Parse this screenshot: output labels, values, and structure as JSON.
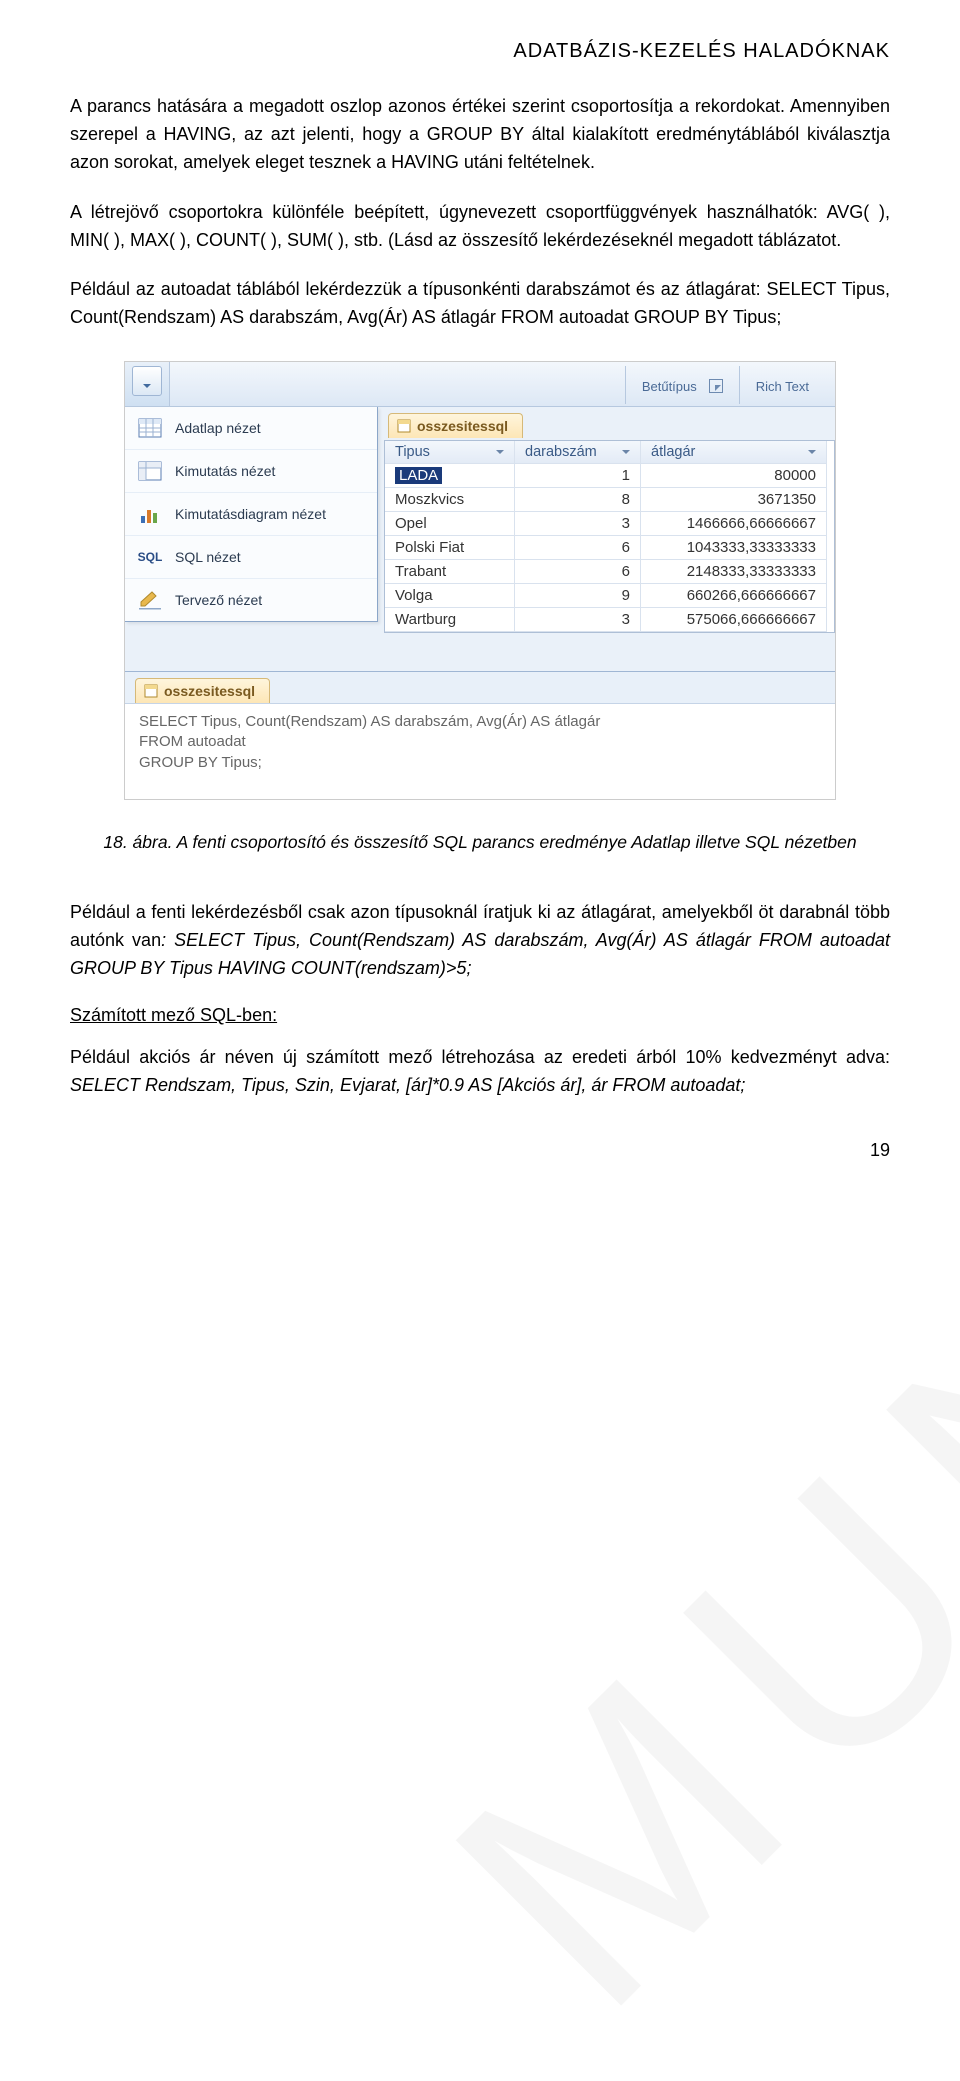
{
  "header": "ADATBÁZIS-KEZELÉS HALADÓKNAK",
  "para1": "A parancs hatására a megadott oszlop azonos értékei szerint csoportosítja a rekordokat. Amennyiben szerepel a HAVING, az azt jelenti, hogy a GROUP BY által kialakított eredménytáblából kiválasztja azon sorokat, amelyek eleget tesznek a HAVING utáni feltételnek.",
  "para2": "A létrejövő csoportokra különféle beépített, úgynevezett csoportfüggvények használhatók: AVG( ), MIN( ), MAX( ), COUNT( ), SUM( ),  stb. (Lásd az összesítő lekérdezéseknél megadott táblázatot.",
  "para3": "Például az autoadat táblából lekérdezzük a típusonkénti darabszámot és az átlagárat: SELECT Tipus, Count(Rendszam) AS darabszám, Avg(Ár) AS átlagár FROM autoadat GROUP BY Tipus;",
  "ribbon": {
    "group_font": "Betűtípus",
    "group_richtext": "Rich Text"
  },
  "view_menu": {
    "items": [
      {
        "label": "Adatlap nézet",
        "icon": "datasheet"
      },
      {
        "label": "Kimutatás nézet",
        "icon": "pivot"
      },
      {
        "label": "Kimutatásdiagram nézet",
        "icon": "pivotchart"
      },
      {
        "label": "SQL nézet",
        "icon": "sql"
      },
      {
        "label": "Tervező nézet",
        "icon": "design"
      }
    ]
  },
  "tab": {
    "name": "osszesitessql"
  },
  "grid": {
    "headers": [
      "Tipus",
      "darabszám",
      "átlagár"
    ],
    "rows": [
      {
        "tipus": "LADA",
        "darab": "1",
        "atlag": "80000",
        "selected": true
      },
      {
        "tipus": "Moszkvics",
        "darab": "8",
        "atlag": "3671350"
      },
      {
        "tipus": "Opel",
        "darab": "3",
        "atlag": "1466666,66666667"
      },
      {
        "tipus": "Polski Fiat",
        "darab": "6",
        "atlag": "1043333,33333333"
      },
      {
        "tipus": "Trabant",
        "darab": "6",
        "atlag": "2148333,33333333"
      },
      {
        "tipus": "Volga",
        "darab": "9",
        "atlag": "660266,666666667"
      },
      {
        "tipus": "Wartburg",
        "darab": "3",
        "atlag": "575066,666666667"
      }
    ]
  },
  "sql_view": {
    "tab": "osszesitessql",
    "line1": "SELECT Tipus, Count(Rendszam) AS darabszám, Avg(Ár) AS átlagár",
    "line2": "FROM autoadat",
    "line3": "GROUP BY Tipus;"
  },
  "caption": "18. ábra. A fenti csoportosító és összesítő SQL parancs eredménye Adatlap illetve SQL nézetben",
  "para4_n": "Például a fenti lekérdezésből csak azon típusoknál íratjuk ki az átlagárat, amelyekből öt darabnál több autónk van",
  "para4_i": ": SELECT Tipus, Count(Rendszam) AS darabszám, Avg(Ár) AS átlagár FROM autoadat GROUP BY Tipus HAVING COUNT(rendszam)>5;",
  "section_title": "Számított mező SQL-ben:",
  "para5_n": "Például akciós ár néven új számított mező létrehozása az eredeti árból 10% kedvezményt adva: ",
  "para5_i": "SELECT Rendszam, Tipus, Szin, Evjarat, [ár]*0.9 AS [Akciós ár], ár FROM autoadat;",
  "pagenum": "19",
  "watermark": "MUNKAANYAG"
}
